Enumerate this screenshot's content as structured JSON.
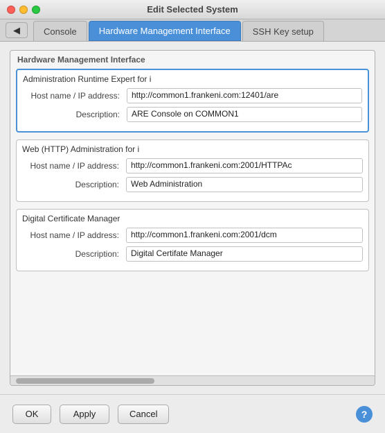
{
  "titleBar": {
    "title": "Edit Selected System"
  },
  "tabs": {
    "back": "◀",
    "items": [
      {
        "id": "console",
        "label": "Console",
        "active": false
      },
      {
        "id": "hmi",
        "label": "Hardware Management Interface",
        "active": true
      },
      {
        "id": "ssh",
        "label": "SSH Key setup",
        "active": false
      }
    ]
  },
  "section": {
    "title": "Hardware Management Interface",
    "interfaces": [
      {
        "id": "are",
        "name": "Administration Runtime Expert for i",
        "selected": true,
        "fields": [
          {
            "label": "Host name / IP address:",
            "value": "http://common1.frankeni.com:12401/are"
          },
          {
            "label": "Description:",
            "value": "ARE Console on COMMON1"
          }
        ]
      },
      {
        "id": "web",
        "name": "Web (HTTP) Administration for i",
        "selected": false,
        "fields": [
          {
            "label": "Host name / IP address:",
            "value": "http://common1.frankeni.com:2001/HTTPAc"
          },
          {
            "label": "Description:",
            "value": "Web Administration"
          }
        ]
      },
      {
        "id": "dcm",
        "name": "Digital Certificate Manager",
        "selected": false,
        "fields": [
          {
            "label": "Host name / IP address:",
            "value": "http://common1.frankeni.com:2001/dcm"
          },
          {
            "label": "Description:",
            "value": "Digital Certifate Manager"
          }
        ]
      }
    ]
  },
  "buttons": {
    "ok": "OK",
    "apply": "Apply",
    "cancel": "Cancel",
    "help": "?"
  }
}
